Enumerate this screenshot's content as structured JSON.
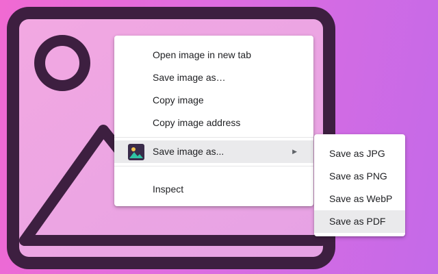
{
  "context_menu": {
    "items": [
      {
        "label": "Open image in new tab"
      },
      {
        "label": "Save image as…"
      },
      {
        "label": "Copy image"
      },
      {
        "label": "Copy image address"
      },
      {
        "label": "Save image as...",
        "has_submenu": true,
        "icon": "extension-image-icon",
        "highlighted": true
      },
      {
        "label": "Inspect"
      }
    ],
    "submenu_arrow": "▶"
  },
  "submenu": {
    "items": [
      {
        "label": "Save as JPG"
      },
      {
        "label": "Save as PNG"
      },
      {
        "label": "Save as WebP"
      },
      {
        "label": "Save as PDF",
        "highlighted": true
      }
    ]
  },
  "colors": {
    "outline": "#3d1f40",
    "menu_bg": "#ffffff",
    "highlight": "#eaeaec",
    "text": "#202124"
  }
}
